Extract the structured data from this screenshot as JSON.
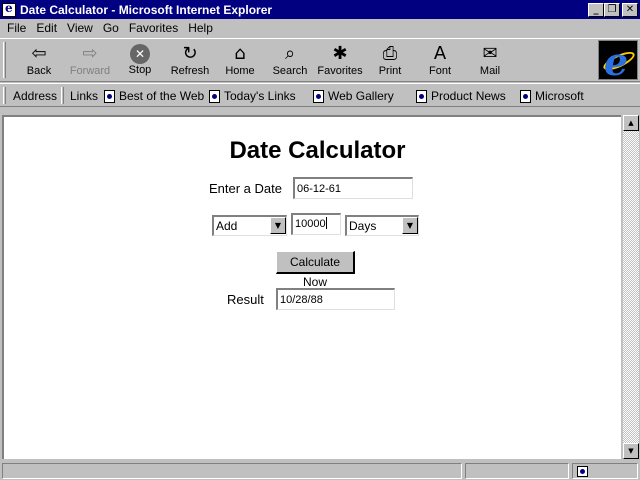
{
  "window": {
    "title": "Date Calculator - Microsoft Internet Explorer",
    "buttons": {
      "minimize": "_",
      "maximize": "❐",
      "close": "✕"
    }
  },
  "menu": [
    "File",
    "Edit",
    "View",
    "Go",
    "Favorites",
    "Help"
  ],
  "toolbar": {
    "buttons": [
      {
        "label": "Back",
        "icon": "back-arrow-icon",
        "glyph": "⇦",
        "enabled": true
      },
      {
        "label": "Forward",
        "icon": "forward-arrow-icon",
        "glyph": "⇨",
        "enabled": false
      },
      {
        "label": "Stop",
        "icon": "stop-icon",
        "glyph": "✕",
        "enabled": true
      },
      {
        "label": "Refresh",
        "icon": "refresh-icon",
        "glyph": "↻",
        "enabled": true
      },
      {
        "label": "Home",
        "icon": "home-icon",
        "glyph": "⌂",
        "enabled": true
      },
      {
        "label": "Search",
        "icon": "search-icon",
        "glyph": "⌕",
        "enabled": true
      },
      {
        "label": "Favorites",
        "icon": "favorites-icon",
        "glyph": "✱",
        "enabled": true
      },
      {
        "label": "Print",
        "icon": "print-icon",
        "glyph": "⎙",
        "enabled": true
      },
      {
        "label": "Font",
        "icon": "font-icon",
        "glyph": "A",
        "enabled": true
      },
      {
        "label": "Mail",
        "icon": "mail-icon",
        "glyph": "✉",
        "enabled": true
      }
    ]
  },
  "linksbar": {
    "address_label": "Address",
    "links_label": "Links",
    "links": [
      "Best of the Web",
      "Today's Links",
      "Web Gallery",
      "Product News",
      "Microsoft"
    ]
  },
  "page": {
    "title": "Date Calculator",
    "date_label": "Enter a Date",
    "date_value": "06-12-61",
    "operation": "Add",
    "amount": "10000",
    "unit": "Days",
    "calculate_label": "Calculate Now",
    "result_label": "Result",
    "result_value": "10/28/88"
  },
  "colors": {
    "titlebar": "#000080",
    "chrome": "#c0c0c0",
    "page_bg": "#ffffff"
  }
}
